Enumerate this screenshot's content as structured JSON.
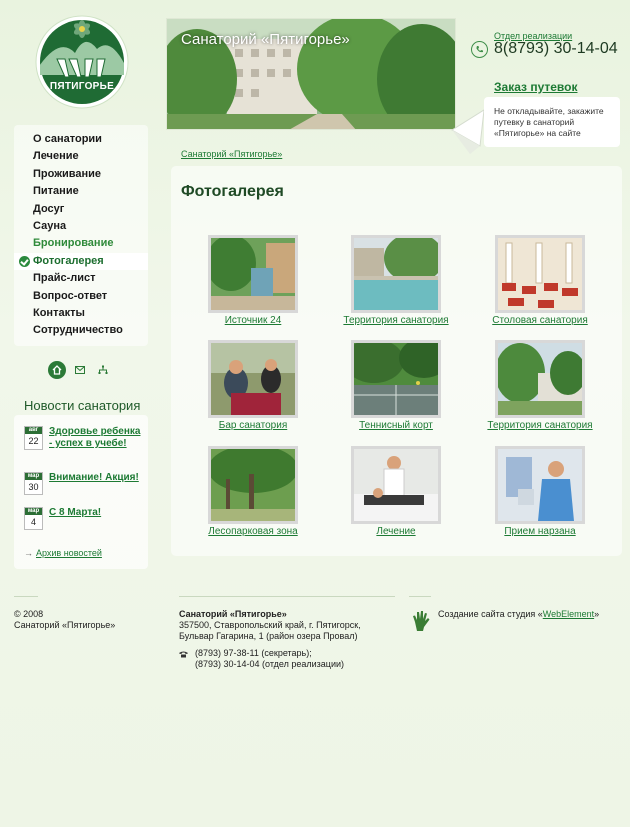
{
  "logo": {
    "text": "ПЯТИГОРЬЕ"
  },
  "header": {
    "title": "Санаторий «Пятигорье»"
  },
  "contact": {
    "department": "Отдел реализации",
    "phone": "8(8793) 30-14-04"
  },
  "order": {
    "title": "Заказ путевок",
    "text": "Не откладывайте, закажите путевку в санаторий «Пятигорье» на сайте"
  },
  "menu": [
    {
      "label": "О санатории"
    },
    {
      "label": "Лечение"
    },
    {
      "label": "Проживание"
    },
    {
      "label": "Питание"
    },
    {
      "label": "Досуг"
    },
    {
      "label": "Сауна"
    },
    {
      "label": "Бронирование"
    },
    {
      "label": "Фотогалерея"
    },
    {
      "label": "Прайс-лист"
    },
    {
      "label": "Вопрос-ответ"
    },
    {
      "label": "Контакты"
    },
    {
      "label": "Сотрудничество"
    }
  ],
  "menu_active": "Фотогалерея",
  "news": {
    "title": "Новости санатория",
    "items": [
      {
        "month": "авг",
        "day": "22",
        "title": "Здоровье ребенка - успех в учебе!"
      },
      {
        "month": "мар",
        "day": "30",
        "title": "Внимание! Акция!"
      },
      {
        "month": "мар",
        "day": "4",
        "title": "С 8 Марта!"
      }
    ],
    "archive": "Архив новостей"
  },
  "breadcrumb": "Санаторий «Пятигорье»",
  "page_title": "Фотогалерея",
  "gallery": [
    {
      "caption": "Источник 24"
    },
    {
      "caption": "Территория санатория"
    },
    {
      "caption": "Столовая санатория"
    },
    {
      "caption": "Бар санатория"
    },
    {
      "caption": "Теннисный корт"
    },
    {
      "caption": "Территория санатория"
    },
    {
      "caption": "Лесопарковая зона"
    },
    {
      "caption": "Лечение"
    },
    {
      "caption": "Прием нарзана"
    }
  ],
  "footer": {
    "year": "© 2008",
    "copyright_name": "Санаторий «Пятигорье»",
    "org_name": "Санаторий «Пятигорье»",
    "address1": "357500, Ставропольский край, г. Пятигорск,",
    "address2": "Бульвар Гагарина, 1 (район озера Провал)",
    "phone1": "(8793) 97-38-11 (секретарь);",
    "phone2": "(8793) 30-14-04 (отдел реализации)",
    "studio_prefix": "Создание сайта студия «",
    "studio_link": "WebElement",
    "studio_suffix": "»"
  },
  "colors": {
    "accent": "#1d7a34",
    "dark_green": "#1f4a25",
    "background": "#eef5e6"
  }
}
